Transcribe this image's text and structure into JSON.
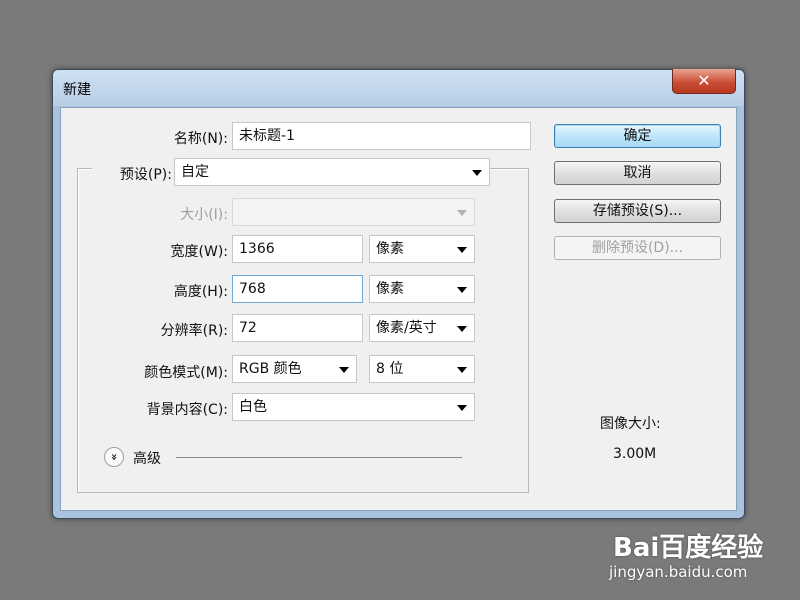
{
  "dialog": {
    "title": "新建",
    "close_glyph": "✕"
  },
  "form": {
    "name": {
      "label": "名称(N):",
      "value": "未标题-1"
    },
    "preset": {
      "label": "预设(P):",
      "value": "自定"
    },
    "size": {
      "label": "大小(I):",
      "value": ""
    },
    "width": {
      "label": "宽度(W):",
      "value": "1366",
      "unit": "像素"
    },
    "height": {
      "label": "高度(H):",
      "value": "768",
      "unit": "像素"
    },
    "resolution": {
      "label": "分辨率(R):",
      "value": "72",
      "unit": "像素/英寸"
    },
    "color_mode": {
      "label": "颜色模式(M):",
      "value": "RGB 颜色",
      "depth": "8 位"
    },
    "background": {
      "label": "背景内容(C):",
      "value": "白色"
    },
    "advanced": {
      "label": "高级",
      "icon": "double-chevron-down-icon",
      "glyph": "»"
    }
  },
  "buttons": {
    "ok": "确定",
    "cancel": "取消",
    "save_preset": "存储预设(S)...",
    "delete_preset": "删除预设(D)..."
  },
  "image_size": {
    "label": "图像大小:",
    "value": "3.00M"
  },
  "watermark": {
    "logo": "Bai百度经验",
    "url": "jingyan.baidu.com"
  },
  "colors": {
    "default_button": "#bee6fd",
    "close_button": "#c94f36"
  }
}
